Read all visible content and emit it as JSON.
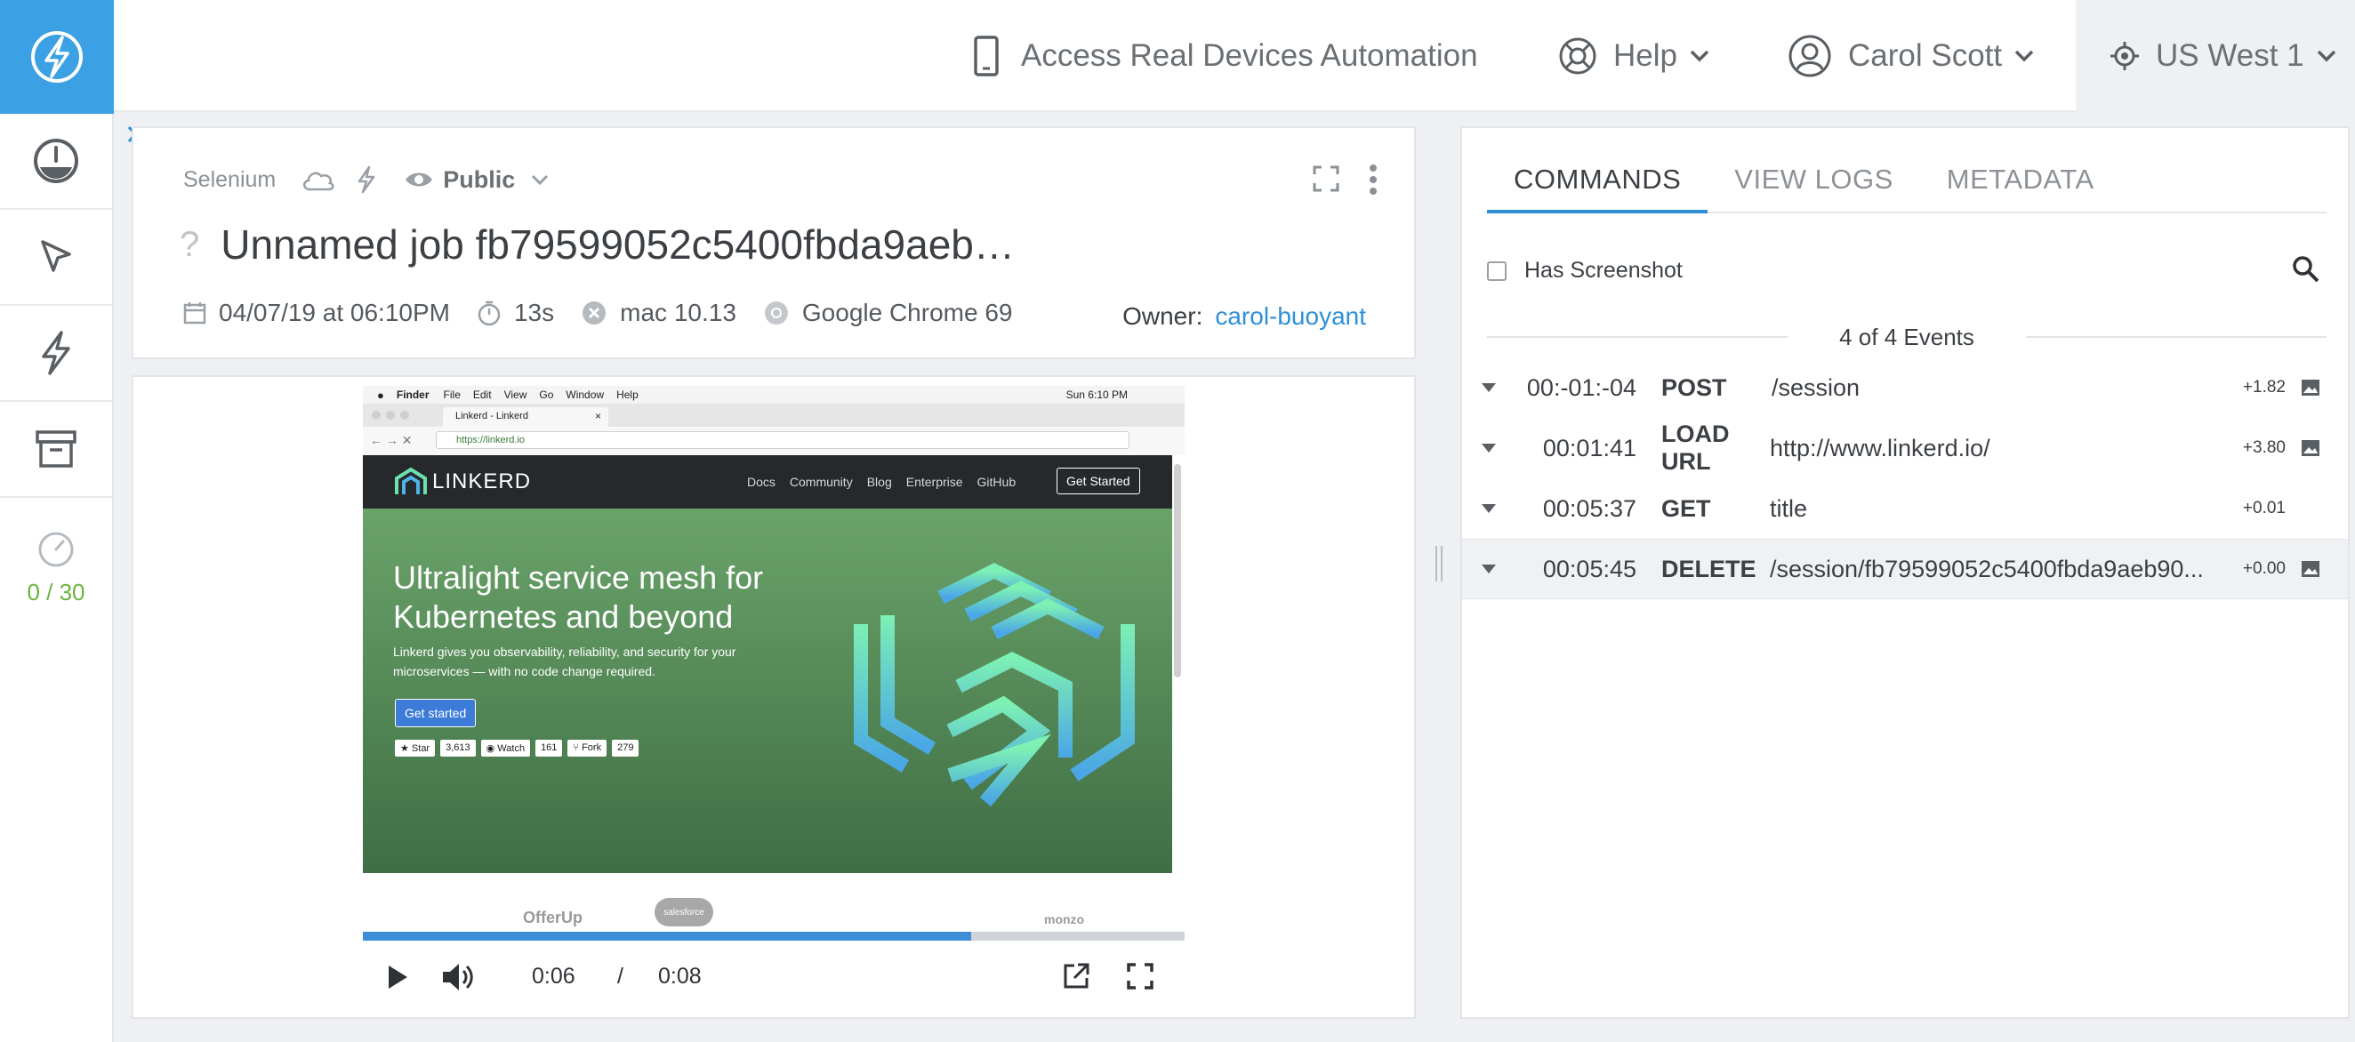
{
  "header": {
    "devices_label": "Access Real Devices Automation",
    "help_label": "Help",
    "user_label": "Carol Scott",
    "region_label": "US West 1"
  },
  "sidebar": {
    "items": [
      {
        "icon": "dashboard-gauge-icon"
      },
      {
        "icon": "automated-cursor-icon"
      },
      {
        "icon": "lightning-icon"
      },
      {
        "icon": "archive-box-icon"
      }
    ],
    "concurrency": "0 / 30"
  },
  "job": {
    "framework": "Selenium",
    "visibility": "Public",
    "title": "Unnamed job fb79599052c5400fbda9aeb…",
    "date": "04/07/19 at 06:10PM",
    "duration": "13s",
    "os": "mac 10.13",
    "browser": "Google Chrome 69",
    "owner_label": "Owner:",
    "owner": "carol-buoyant"
  },
  "video": {
    "current_time": "0:06",
    "separator": "/",
    "total_time": "0:08",
    "progress": 0.74,
    "screenshot": {
      "menu_app": "Finder",
      "menu_items": [
        "File",
        "Edit",
        "View",
        "Go",
        "Window",
        "Help"
      ],
      "menu_clock": "Sun 6:10 PM",
      "tab_title": "Linkerd - Linkerd",
      "url": "https://linkerd.io",
      "brand": "LINKERD",
      "nav": [
        "Docs",
        "Community",
        "Blog",
        "Enterprise",
        "GitHub"
      ],
      "nav_cta": "Get Started",
      "headline_1": "Ultralight service mesh for",
      "headline_2": "Kubernetes and beyond",
      "sub_1": "Linkerd gives you observability, reliability, and security for your",
      "sub_2": "microservices — with no code change required.",
      "hero_cta": "Get started",
      "gh_star": "Star",
      "gh_star_count": "3,613",
      "gh_watch": "Watch",
      "gh_watch_count": "161",
      "gh_fork": "Fork",
      "gh_fork_count": "279",
      "logos": [
        "OfferUp",
        "salesforce",
        "monzo"
      ]
    }
  },
  "commands": {
    "tabs": [
      "COMMANDS",
      "VIEW LOGS",
      "METADATA"
    ],
    "has_screenshot_label": "Has Screenshot",
    "events_summary": "4 of 4 Events",
    "rows": [
      {
        "time": "00:-01:-04",
        "verb": "POST",
        "arg": "/session",
        "delta": "+1.82"
      },
      {
        "time": "00:01:41",
        "verb": "LOAD URL",
        "arg": "http://www.linkerd.io/",
        "delta": "+3.80"
      },
      {
        "time": "00:05:37",
        "verb": "GET",
        "arg": "title",
        "delta": "+0.01"
      },
      {
        "time": "00:05:45",
        "verb": "DELETE",
        "arg": "/session/fb79599052c5400fbda9aeb90...",
        "delta": "+0.00"
      }
    ]
  },
  "colors": {
    "brand_blue": "#3ba0e4",
    "link_blue": "#2f8fd6",
    "concurrency_green": "#6cb33e",
    "linkerd_green": "#4f8a4f"
  }
}
